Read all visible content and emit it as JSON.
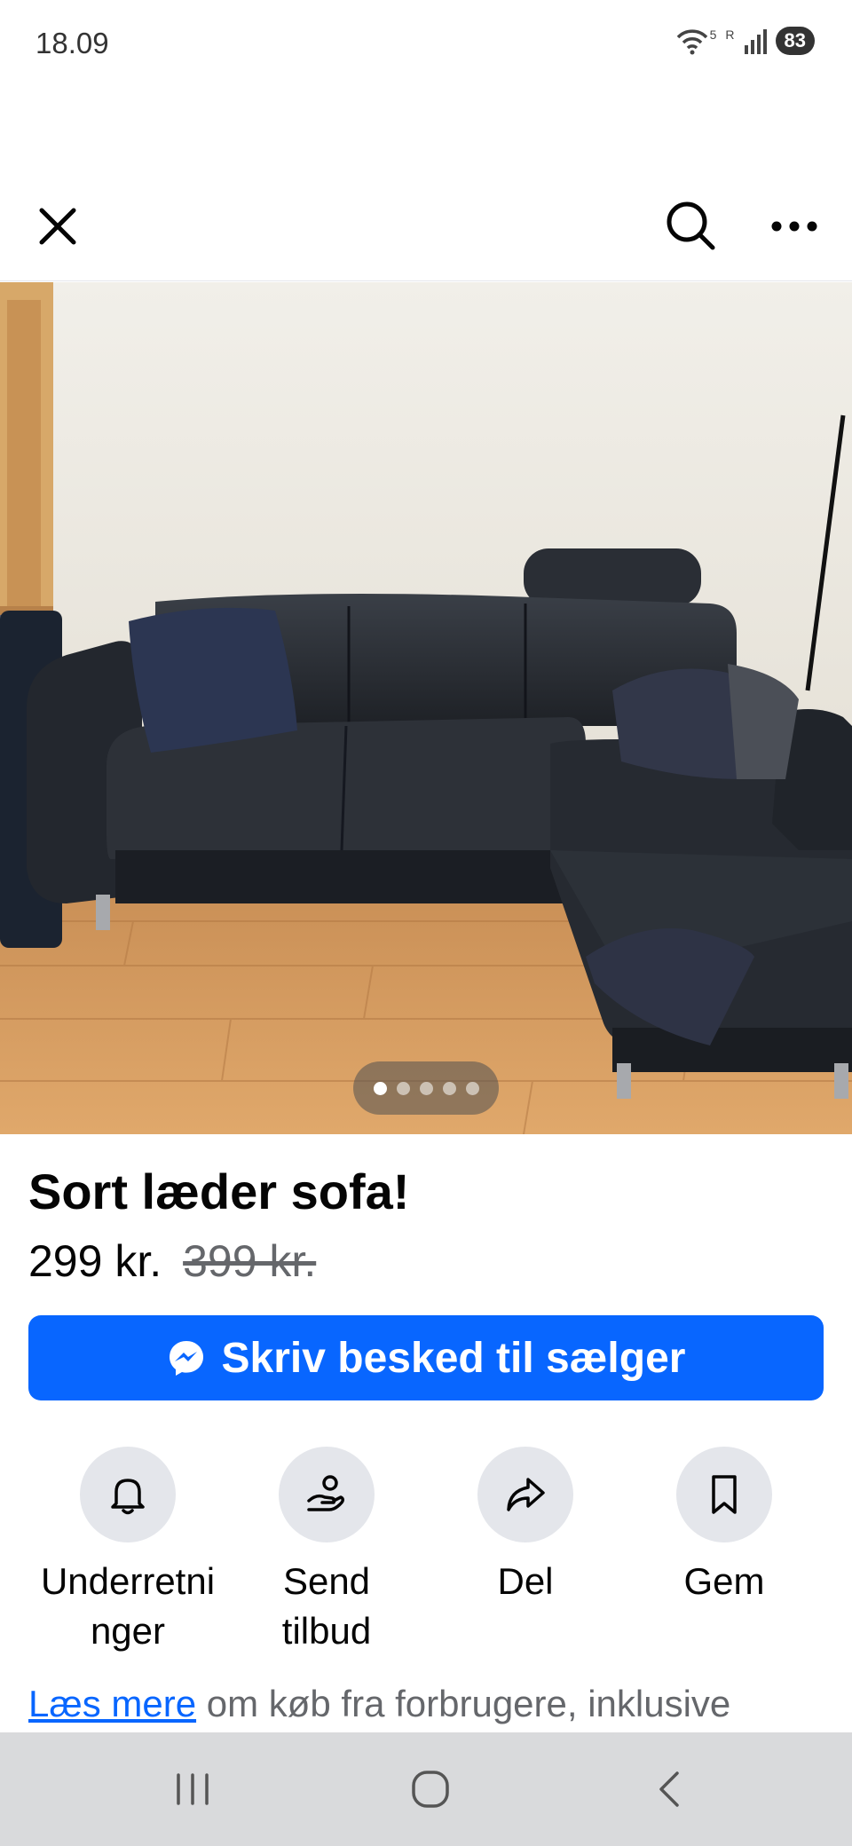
{
  "status_bar": {
    "time": "18.09",
    "battery": "83",
    "network": "5",
    "roaming": "R"
  },
  "listing": {
    "title": "Sort læder sofa!",
    "price": "299 kr.",
    "original_price": "399 kr.",
    "photo_count": 5,
    "photo_index": 1
  },
  "message_button": {
    "label": "Skriv besked til sælger"
  },
  "actions": [
    {
      "label": "Underretni\nnger",
      "icon": "bell-icon"
    },
    {
      "label": "Send tilbud",
      "icon": "offer-hand-icon"
    },
    {
      "label": "Del",
      "icon": "share-icon"
    },
    {
      "label": "Gem",
      "icon": "bookmark-icon"
    }
  ],
  "info": {
    "link_text": "Læs mere",
    "text": " om køb fra forbrugere, inklusive"
  },
  "colors": {
    "accent": "#0866ff",
    "action_bg": "#e4e6eb",
    "nav_bg": "#d9dadc"
  }
}
